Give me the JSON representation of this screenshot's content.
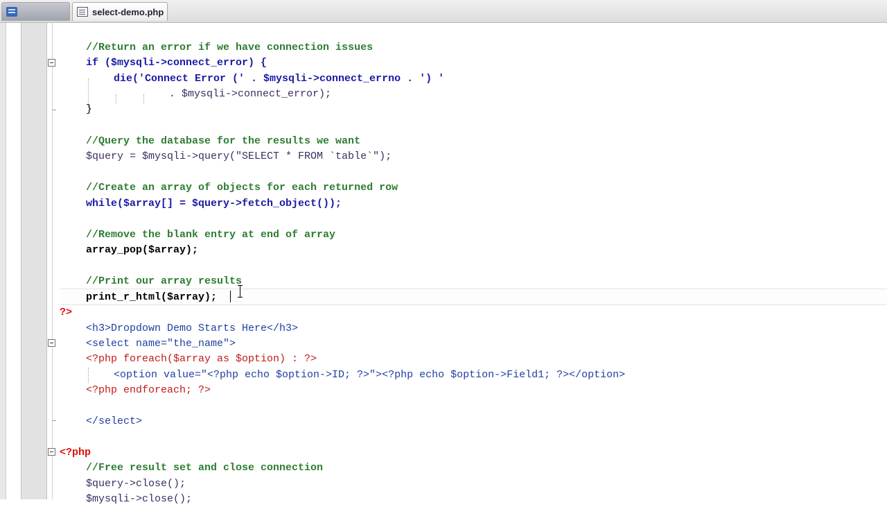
{
  "tabs": [
    {
      "label": "",
      "icon": "database-icon",
      "active": false
    },
    {
      "label": "select-demo.php",
      "icon": "file-icon",
      "active": true
    }
  ],
  "code_lines": [
    "//Return an error if we have connection issues",
    "if ($mysqli->connect_error) {",
    "die('Connect Error (' . $mysqli->connect_errno . ') '",
    ". $mysqli->connect_error);",
    "}",
    "//Query the database for the results we want",
    "$query = $mysqli->query(\"SELECT * FROM `table`\");",
    "//Create an array of objects for each returned row",
    "while($array[] = $query->fetch_object());",
    "//Remove the blank entry at end of array",
    "array_pop($array);",
    "//Print our array results",
    "print_r_html($array);",
    "?>",
    "<h3>Dropdown Demo Starts Here</h3>",
    "<select name=\"the_name\">",
    "<?php foreach($array as $option) : ?>",
    "<option value=\"<?php echo $option->ID; ?>\"><?php echo $option->Field1; ?></option>",
    "<?php endforeach; ?>",
    "</select>",
    "<?php",
    "//Free result set and close connection",
    "$query->close();",
    "$mysqli->close();"
  ]
}
